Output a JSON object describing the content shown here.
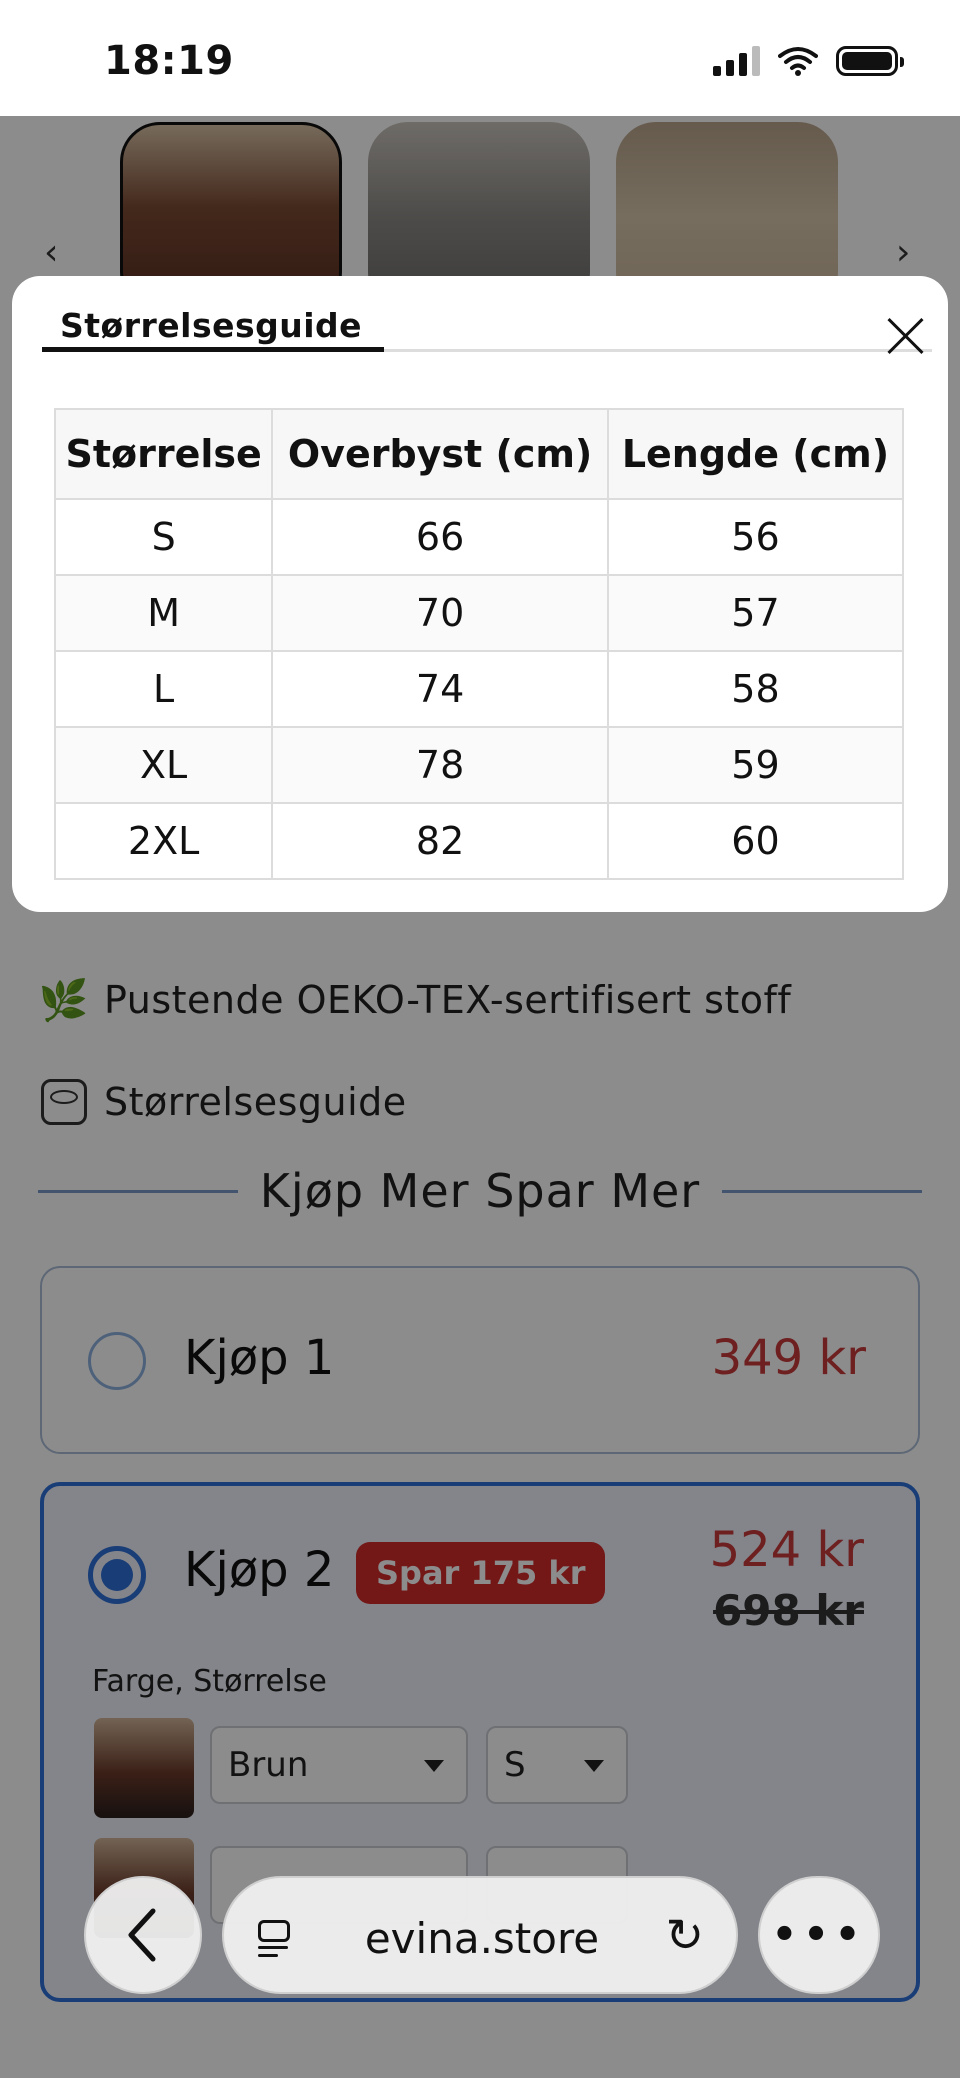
{
  "status_bar": {
    "time": "18:19"
  },
  "product": {
    "features": [
      {
        "icon": "leaf-icon",
        "text": "Pustende OEKO-TEX-sertifisert stoff"
      },
      {
        "icon": "measuring-tape-icon",
        "text": "Størrelsesguide"
      }
    ],
    "promo_heading": "Kjøp Mer Spar Mer",
    "offers": [
      {
        "title": "Kjøp 1",
        "price": "349 kr",
        "selected": false
      },
      {
        "title": "Kjøp 2",
        "badge": "Spar 175 kr",
        "price": "524 kr",
        "old_price": "698 kr",
        "selected": true,
        "variant_label": "Farge, Størrelse",
        "variant_color": "Brun",
        "variant_size": "S"
      }
    ]
  },
  "modal": {
    "tab_label": "Størrelsesguide",
    "table": {
      "headers": [
        "Størrelse",
        "Overbyst (cm)",
        "Lengde (cm)"
      ],
      "rows": [
        [
          "S",
          "66",
          "56"
        ],
        [
          "M",
          "70",
          "57"
        ],
        [
          "L",
          "74",
          "58"
        ],
        [
          "XL",
          "78",
          "59"
        ],
        [
          "2XL",
          "82",
          "60"
        ]
      ]
    }
  },
  "browser": {
    "url": "evina.store"
  }
}
